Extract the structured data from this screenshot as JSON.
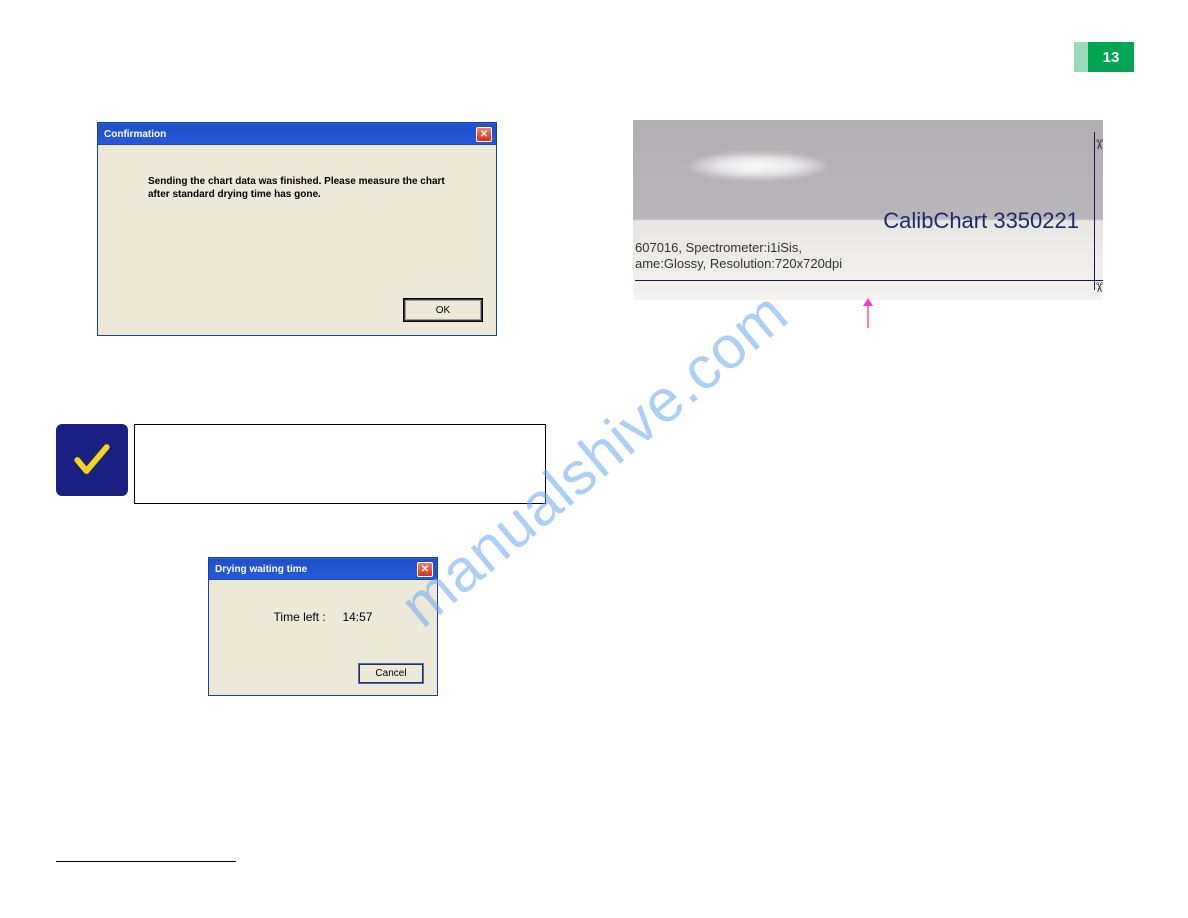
{
  "page_number": "13",
  "dialog1": {
    "title": "Confirmation",
    "message": "Sending the chart data was finished. Please measure the chart after standard drying time has gone.",
    "ok": "OK"
  },
  "dialog2": {
    "title": "Drying waiting time",
    "label": "Time left :",
    "time": "14:57",
    "cancel": "Cancel"
  },
  "photo": {
    "title": "CalibChart 3350221",
    "line1": "607016, Spectrometer:i1iSis,",
    "line2": "ame:Glossy, Resolution:720x720dpi"
  },
  "watermark": "manualshive.com"
}
